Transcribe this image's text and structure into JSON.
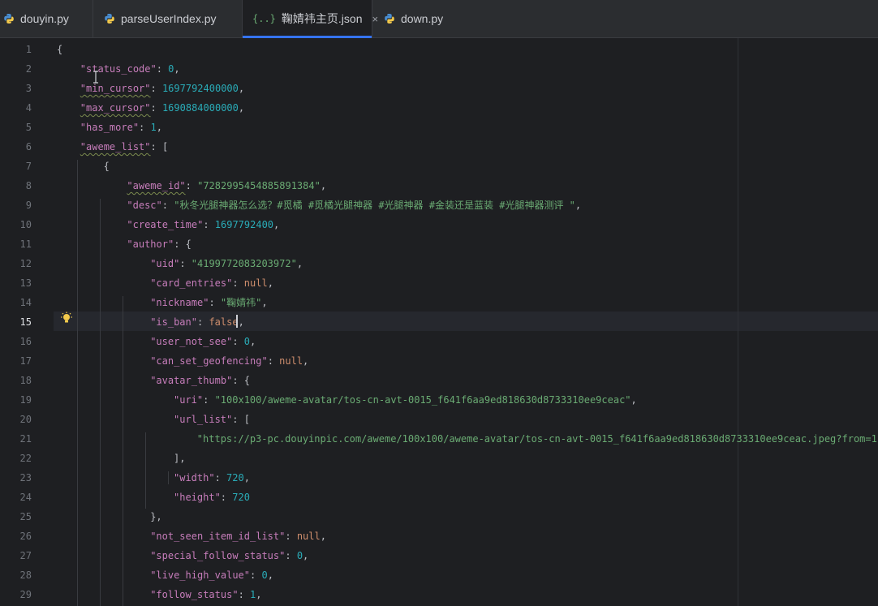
{
  "tabs": [
    {
      "label": "douyin.py",
      "icon": "python-icon",
      "active": false
    },
    {
      "label": "parseUserIndex.py",
      "icon": "python-icon",
      "active": false
    },
    {
      "label": "鞠婧祎主页.json",
      "icon": "json-icon",
      "active": true
    },
    {
      "label": "down.py",
      "icon": "python-icon",
      "active": false
    }
  ],
  "json_icon_glyph": "{..}",
  "close_glyph": "×",
  "colors": {
    "key": "#c77dbb",
    "string": "#6aab73",
    "number": "#2aacb8",
    "keyword": "#cf8e6d",
    "accent": "#3574f0"
  },
  "editor": {
    "current_line": 15,
    "line_numbers": [
      "1",
      "2",
      "3",
      "4",
      "5",
      "6",
      "7",
      "8",
      "9",
      "10",
      "11",
      "12",
      "13",
      "14",
      "15",
      "16",
      "17",
      "18",
      "19",
      "20",
      "21",
      "22",
      "23",
      "24",
      "25",
      "26",
      "27",
      "28",
      "29"
    ],
    "lines": [
      [
        {
          "t": "p",
          "v": "{"
        }
      ],
      [
        {
          "t": "k",
          "v": "\"status_code\""
        },
        {
          "t": "p",
          "v": ": "
        },
        {
          "t": "n",
          "v": "0"
        },
        {
          "t": "p",
          "v": ","
        }
      ],
      [
        {
          "t": "k",
          "v": "\"min_cursor\""
        },
        {
          "t": "p",
          "v": ": "
        },
        {
          "t": "n",
          "v": "1697792400000"
        },
        {
          "t": "p",
          "v": ","
        }
      ],
      [
        {
          "t": "k",
          "v": "\"max_cursor\""
        },
        {
          "t": "p",
          "v": ": "
        },
        {
          "t": "n",
          "v": "1690884000000"
        },
        {
          "t": "p",
          "v": ","
        }
      ],
      [
        {
          "t": "k",
          "v": "\"has_more\""
        },
        {
          "t": "p",
          "v": ": "
        },
        {
          "t": "n",
          "v": "1"
        },
        {
          "t": "p",
          "v": ","
        }
      ],
      [
        {
          "t": "k",
          "v": "\"aweme_list\""
        },
        {
          "t": "p",
          "v": ": ["
        }
      ],
      [
        {
          "t": "p",
          "v": "{"
        }
      ],
      [
        {
          "t": "k",
          "v": "\"aweme_id\""
        },
        {
          "t": "p",
          "v": ": "
        },
        {
          "t": "s",
          "v": "\"7282995454885891384\""
        },
        {
          "t": "p",
          "v": ","
        }
      ],
      [
        {
          "t": "k",
          "v": "\"desc\""
        },
        {
          "t": "p",
          "v": ": "
        },
        {
          "t": "s",
          "v": "\"秋冬光腿神器怎么选？#觅橘 #觅橘光腿神器 #光腿神器 #金装还是蓝装 #光腿神器测评 \""
        },
        {
          "t": "p",
          "v": ","
        }
      ],
      [
        {
          "t": "k",
          "v": "\"create_time\""
        },
        {
          "t": "p",
          "v": ": "
        },
        {
          "t": "n",
          "v": "1697792400"
        },
        {
          "t": "p",
          "v": ","
        }
      ],
      [
        {
          "t": "k",
          "v": "\"author\""
        },
        {
          "t": "p",
          "v": ": {"
        }
      ],
      [
        {
          "t": "k",
          "v": "\"uid\""
        },
        {
          "t": "p",
          "v": ": "
        },
        {
          "t": "s",
          "v": "\"4199772083203972\""
        },
        {
          "t": "p",
          "v": ","
        }
      ],
      [
        {
          "t": "k",
          "v": "\"card_entries\""
        },
        {
          "t": "p",
          "v": ": "
        },
        {
          "t": "kw",
          "v": "null"
        },
        {
          "t": "p",
          "v": ","
        }
      ],
      [
        {
          "t": "k",
          "v": "\"nickname\""
        },
        {
          "t": "p",
          "v": ": "
        },
        {
          "t": "s",
          "v": "\"鞠婧祎\""
        },
        {
          "t": "p",
          "v": ","
        }
      ],
      [
        {
          "t": "k",
          "v": "\"is_ban\""
        },
        {
          "t": "p",
          "v": ": "
        },
        {
          "t": "kw",
          "v": "false"
        },
        {
          "t": "p",
          "v": ","
        }
      ],
      [
        {
          "t": "k",
          "v": "\"user_not_see\""
        },
        {
          "t": "p",
          "v": ": "
        },
        {
          "t": "n",
          "v": "0"
        },
        {
          "t": "p",
          "v": ","
        }
      ],
      [
        {
          "t": "k",
          "v": "\"can_set_geofencing\""
        },
        {
          "t": "p",
          "v": ": "
        },
        {
          "t": "kw",
          "v": "null"
        },
        {
          "t": "p",
          "v": ","
        }
      ],
      [
        {
          "t": "k",
          "v": "\"avatar_thumb\""
        },
        {
          "t": "p",
          "v": ": {"
        }
      ],
      [
        {
          "t": "k",
          "v": "\"uri\""
        },
        {
          "t": "p",
          "v": ": "
        },
        {
          "t": "s",
          "v": "\"100x100/aweme-avatar/tos-cn-avt-0015_f641f6aa9ed818630d8733310ee9ceac\""
        },
        {
          "t": "p",
          "v": ","
        }
      ],
      [
        {
          "t": "k",
          "v": "\"url_list\""
        },
        {
          "t": "p",
          "v": ": ["
        }
      ],
      [
        {
          "t": "s",
          "v": "\"https://p3-pc.douyinpic.com/aweme/100x100/aweme-avatar/tos-cn-avt-0015_f641f6aa9ed818630d8733310ee9ceac.jpeg?from=11635"
        }
      ],
      [
        {
          "t": "p",
          "v": "],"
        }
      ],
      [
        {
          "t": "k",
          "v": "\"width\""
        },
        {
          "t": "p",
          "v": ": "
        },
        {
          "t": "n",
          "v": "720"
        },
        {
          "t": "p",
          "v": ","
        }
      ],
      [
        {
          "t": "k",
          "v": "\"height\""
        },
        {
          "t": "p",
          "v": ": "
        },
        {
          "t": "n",
          "v": "720"
        }
      ],
      [
        {
          "t": "p",
          "v": "},"
        }
      ],
      [
        {
          "t": "k",
          "v": "\"not_seen_item_id_list\""
        },
        {
          "t": "p",
          "v": ": "
        },
        {
          "t": "kw",
          "v": "null"
        },
        {
          "t": "p",
          "v": ","
        }
      ],
      [
        {
          "t": "k",
          "v": "\"special_follow_status\""
        },
        {
          "t": "p",
          "v": ": "
        },
        {
          "t": "n",
          "v": "0"
        },
        {
          "t": "p",
          "v": ","
        }
      ],
      [
        {
          "t": "k",
          "v": "\"live_high_value\""
        },
        {
          "t": "p",
          "v": ": "
        },
        {
          "t": "n",
          "v": "0"
        },
        {
          "t": "p",
          "v": ","
        }
      ],
      [
        {
          "t": "k",
          "v": "\"follow_status\""
        },
        {
          "t": "p",
          "v": ": "
        },
        {
          "t": "n",
          "v": "1"
        },
        {
          "t": "p",
          "v": ","
        }
      ]
    ]
  }
}
